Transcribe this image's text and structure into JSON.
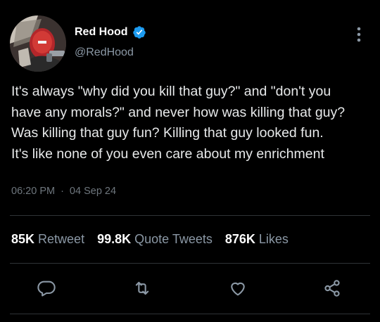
{
  "user": {
    "display_name": "Red Hood",
    "handle": "@RedHood",
    "verified_icon": "verified-badge-icon",
    "verified_color": "#1d9bf0"
  },
  "tweet": {
    "text": "It's always \"why did you kill that guy?\" and \"don't you\nhave any morals?\" and never how was killing that guy?\nWas killing that guy fun? Killing that guy looked fun.\nIt's like none of you even care about my enrichment",
    "time": "06:20 PM",
    "separator": "·",
    "date": "04 Sep 24"
  },
  "stats": {
    "retweets_count": "85K",
    "retweets_label": "Retweet",
    "quotes_count": "99.8K",
    "quotes_label": "Quote Tweets",
    "likes_count": "876K",
    "likes_label": "Likes"
  },
  "actions": {
    "reply_icon": "reply-icon",
    "retweet_icon": "retweet-icon",
    "like_icon": "heart-icon",
    "share_icon": "share-icon"
  },
  "colors": {
    "background": "#000000",
    "text": "#e7e9ea",
    "muted": "#8b98a5",
    "divider": "#2f3336"
  }
}
